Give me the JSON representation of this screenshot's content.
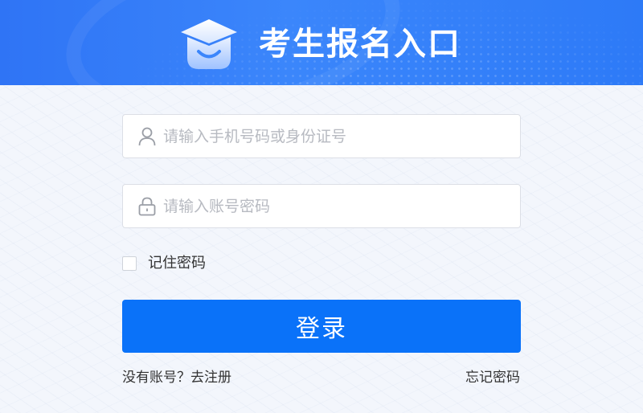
{
  "header": {
    "title": "考生报名入口",
    "logo_icon": "graduation-cap-smile-icon",
    "background_color": "#2f74f5"
  },
  "form": {
    "account_field": {
      "icon": "user-icon",
      "placeholder": "请输入手机号码或身份证号",
      "value": ""
    },
    "password_field": {
      "icon": "lock-icon",
      "placeholder": "请输入账号密码",
      "value": ""
    },
    "remember": {
      "label": "记住密码",
      "checked": false
    },
    "login_button": {
      "label": "登录",
      "color": "#0a72f9"
    },
    "register_link": "没有账号？去注册",
    "forgot_link": "忘记密码"
  }
}
